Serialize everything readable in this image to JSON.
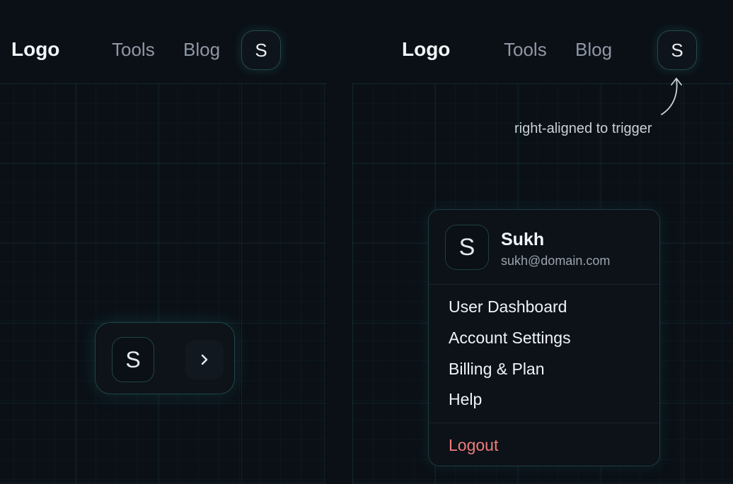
{
  "left_panel": {
    "logo": "Logo",
    "nav": [
      "Tools",
      "Blog"
    ],
    "avatar_initial": "S",
    "collapsed_menu": {
      "avatar_initial": "S",
      "chevron_icon": "chevron-right-icon"
    }
  },
  "right_panel": {
    "logo": "Logo",
    "nav": [
      "Tools",
      "Blog"
    ],
    "avatar_initial": "S",
    "annotation": "right-aligned to trigger",
    "dropdown": {
      "avatar_initial": "S",
      "user_name": "Sukh",
      "user_email": "sukh@domain.com",
      "items": [
        "User Dashboard",
        "Account Settings",
        "Billing & Plan",
        "Help"
      ],
      "logout": "Logout"
    }
  },
  "colors": {
    "background": "#0b1017",
    "accent_glow": "#2a968c",
    "logout": "#ef7b7b"
  }
}
